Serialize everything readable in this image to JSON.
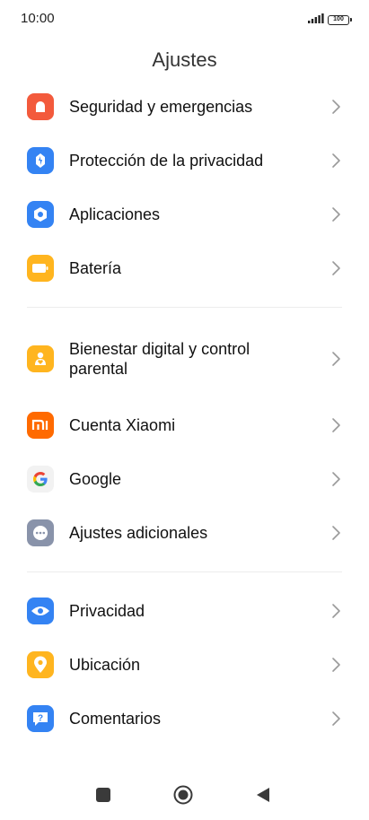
{
  "status_bar": {
    "time": "10:00",
    "battery": "100",
    "signal_icon": "signal-icon"
  },
  "header": {
    "title": "Ajustes"
  },
  "groups": [
    {
      "items": [
        {
          "label": "Seguridad y emergencias",
          "icon": "alert-icon",
          "color": "#F35A3C"
        },
        {
          "label": "Protección de la privacidad",
          "icon": "shield-icon",
          "color": "#3483F3"
        },
        {
          "label": "Aplicaciones",
          "icon": "apps-icon",
          "color": "#3483F3"
        },
        {
          "label": "Batería",
          "icon": "battery-icon",
          "color": "#FFB51F"
        }
      ]
    },
    {
      "items": [
        {
          "label": "Bienestar digital y control parental",
          "icon": "wellbeing-icon",
          "color": "#FFB51F"
        },
        {
          "label": "Cuenta Xiaomi",
          "icon": "mi-icon",
          "color": "#FF6A00"
        },
        {
          "label": "Google",
          "icon": "google-icon",
          "color": "#F2F2F2"
        },
        {
          "label": "Ajustes adicionales",
          "icon": "more-icon",
          "color": "#8993AA"
        }
      ]
    },
    {
      "items": [
        {
          "label": "Privacidad",
          "icon": "eye-icon",
          "color": "#3483F3"
        },
        {
          "label": "Ubicación",
          "icon": "location-icon",
          "color": "#FFB51F"
        },
        {
          "label": "Comentarios",
          "icon": "feedback-icon",
          "color": "#3483F3"
        }
      ]
    }
  ],
  "nav": {
    "recents": "square-icon",
    "home": "home-circle-icon",
    "back": "back-triangle-icon"
  }
}
